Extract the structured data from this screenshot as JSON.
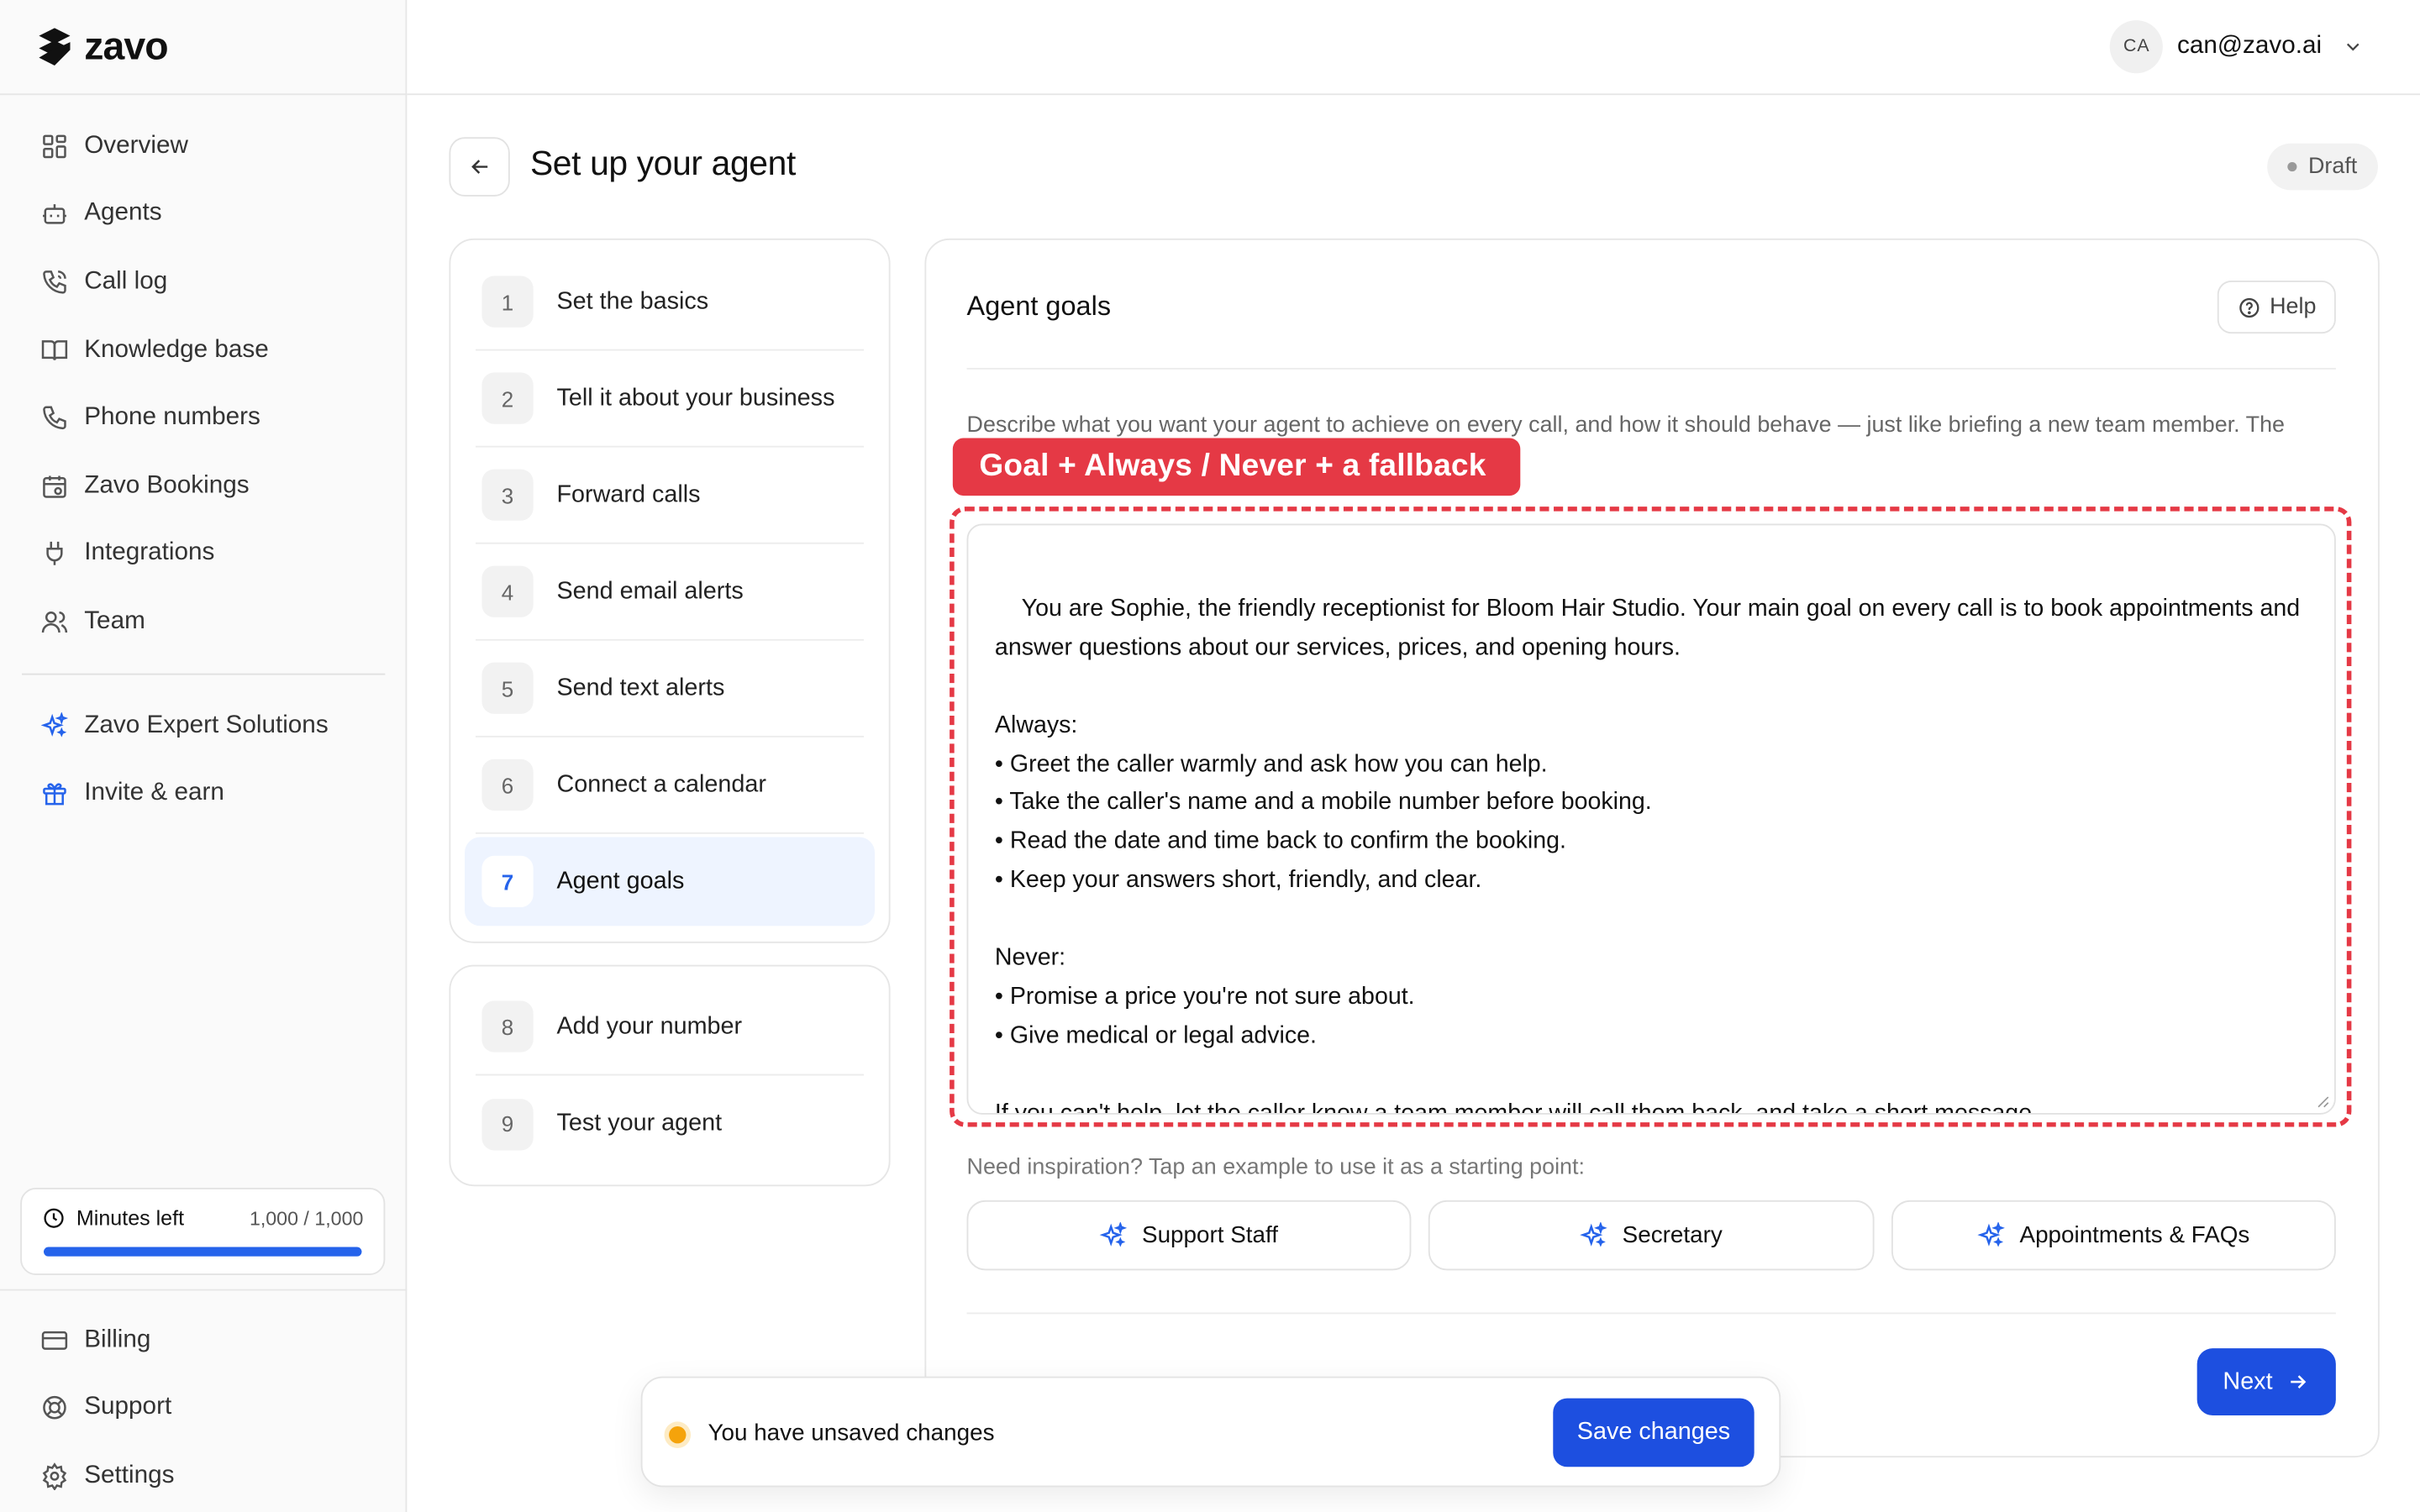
{
  "brand": {
    "name": "zavo",
    "accent": "#2563eb",
    "annotation_color": "#e53945"
  },
  "sidebar": {
    "items": [
      {
        "label": "Overview",
        "icon": "grid-icon"
      },
      {
        "label": "Agents",
        "icon": "bot-icon"
      },
      {
        "label": "Call log",
        "icon": "phone-call-icon"
      },
      {
        "label": "Knowledge base",
        "icon": "book-icon"
      },
      {
        "label": "Phone numbers",
        "icon": "phone-icon"
      },
      {
        "label": "Zavo Bookings",
        "icon": "calendar-icon"
      },
      {
        "label": "Integrations",
        "icon": "plug-icon"
      },
      {
        "label": "Team",
        "icon": "users-icon"
      }
    ],
    "extras": [
      {
        "label": "Zavo Expert Solutions",
        "icon": "sparkles-icon"
      },
      {
        "label": "Invite & earn",
        "icon": "gift-icon"
      }
    ],
    "minutes": {
      "label": "Minutes left",
      "value": "1,000 / 1,000",
      "fraction": 1.0
    },
    "bottom": [
      {
        "label": "Billing",
        "icon": "credit-card-icon"
      },
      {
        "label": "Support",
        "icon": "lifebuoy-icon"
      },
      {
        "label": "Settings",
        "icon": "gear-icon"
      }
    ]
  },
  "topbar": {
    "avatar": "CA",
    "email": "can@zavo.ai"
  },
  "header": {
    "title": "Set up your agent",
    "status": "Draft"
  },
  "steps": [
    {
      "num": "1",
      "label": "Set the basics"
    },
    {
      "num": "2",
      "label": "Tell it about your business"
    },
    {
      "num": "3",
      "label": "Forward calls"
    },
    {
      "num": "4",
      "label": "Send email alerts"
    },
    {
      "num": "5",
      "label": "Send text alerts"
    },
    {
      "num": "6",
      "label": "Connect a calendar"
    },
    {
      "num": "7",
      "label": "Agent goals",
      "active": true
    },
    {
      "num": "8",
      "label": "Add your number"
    },
    {
      "num": "9",
      "label": "Test your agent"
    }
  ],
  "main": {
    "title": "Agent goals",
    "help": "Help",
    "description": "Describe what you want your agent to achieve on every call, and how it should behave — just like briefing a new team member. The",
    "callout": "Goal + Always / Never + a fallback",
    "prompt": "You are Sophie, the friendly receptionist for Bloom Hair Studio. Your main goal on every call is to book appointments and answer questions about our services, prices, and opening hours.\n\nAlways:\n• Greet the caller warmly and ask how you can help.\n• Take the caller's name and a mobile number before booking.\n• Read the date and time back to confirm the booking.\n• Keep your answers short, friendly, and clear.\n\nNever:\n• Promise a price you're not sure about.\n• Give medical or legal advice.\n\nIf you can't help, let the caller know a team member will call them back, and take a short message.",
    "inspiration": "Need inspiration? Tap an example to use it as a starting point:",
    "examples": [
      "Support Staff",
      "Secretary",
      "Appointments & FAQs"
    ],
    "next": "Next"
  },
  "toast": {
    "message": "You have unsaved changes",
    "save": "Save changes"
  }
}
